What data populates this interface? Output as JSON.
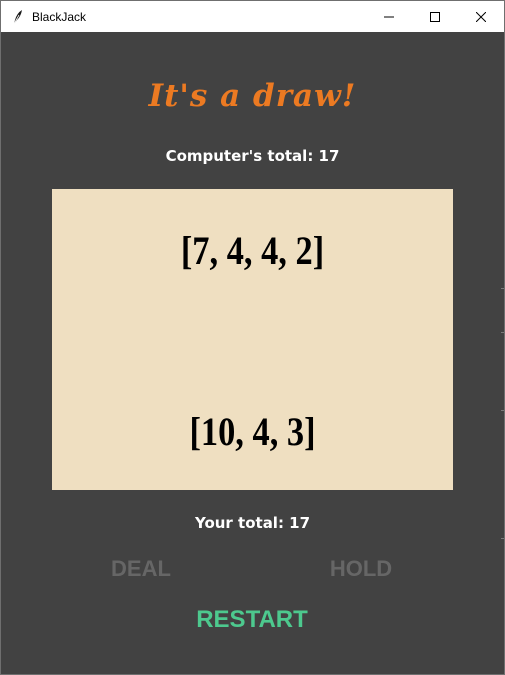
{
  "window": {
    "title": "BlackJack",
    "controls": {
      "minimize": "minimize-icon",
      "maximize": "maximize-icon",
      "close": "close-icon"
    }
  },
  "game": {
    "status": "It's a draw!",
    "computer_total_text": "Computer's total: 17",
    "computer_hand": "[7, 4, 4, 2]",
    "player_hand": "[10, 4, 3]",
    "player_total_text": "Your total: 17"
  },
  "buttons": {
    "deal": "DEAL",
    "hold": "HOLD",
    "restart": "RESTART"
  },
  "colors": {
    "background": "#424242",
    "status": "#ec7a22",
    "table": "#efdfc1",
    "restart": "#4dc98e",
    "disabled": "#666666"
  }
}
